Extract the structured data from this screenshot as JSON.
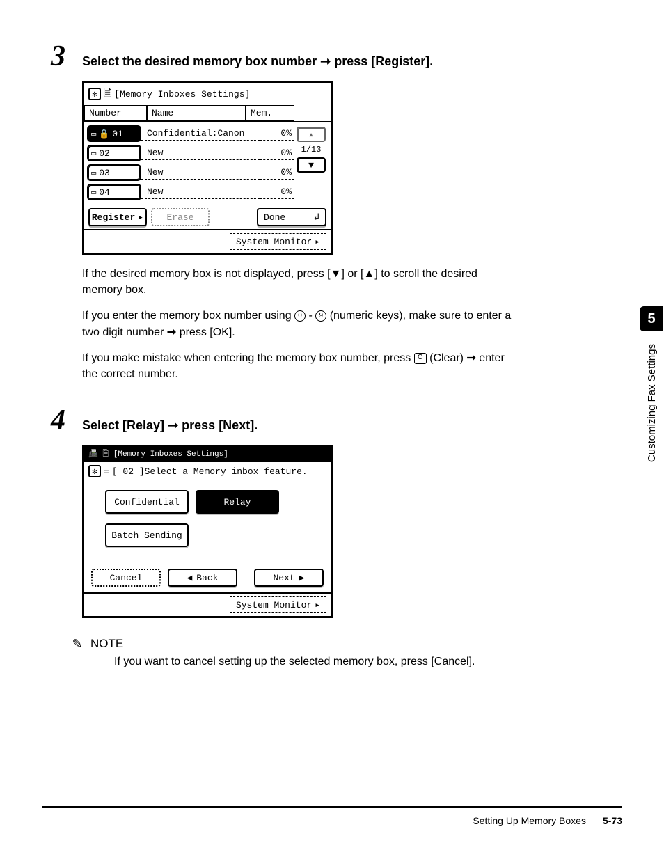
{
  "steps": {
    "s3": {
      "num": "3",
      "title_a": "Select the desired memory box number ",
      "title_arrow": "➞",
      "title_b": " press [Register]."
    },
    "s4": {
      "num": "4",
      "title_a": "Select [Relay] ",
      "title_arrow": "➞",
      "title_b": " press [Next]."
    }
  },
  "screen1": {
    "title": "[Memory Inboxes Settings]",
    "headers": {
      "num": "Number",
      "name": "Name",
      "mem": "Mem."
    },
    "rows": [
      {
        "num": "01",
        "name": "Confidential:Canon",
        "mem": "0%",
        "selected": true,
        "locked": true
      },
      {
        "num": "02",
        "name": "New",
        "mem": "0%",
        "selected": false,
        "locked": false
      },
      {
        "num": "03",
        "name": "New",
        "mem": "0%",
        "selected": false,
        "locked": false
      },
      {
        "num": "04",
        "name": "New",
        "mem": "0%",
        "selected": false,
        "locked": false
      }
    ],
    "page_indicator": "1/13",
    "register": "Register",
    "erase": "Erase",
    "done": "Done",
    "sysmon": "System Monitor"
  },
  "para1_a": "If the desired memory box is not displayed, press [",
  "para1_b": "] or [",
  "para1_c": "] to scroll the desired memory box.",
  "para2_a": "If you enter the memory box number using ",
  "para2_dash": " - ",
  "para2_b": " (numeric keys), make sure to enter a two digit number ",
  "para2_arrow": "➞",
  "para2_c": " press [OK].",
  "para3_a": "If you make mistake when entering the memory box number, press ",
  "para3_b": " (Clear) ",
  "para3_arrow": "➞",
  "para3_c": " enter the correct number.",
  "screen2": {
    "crumb": "[Memory Inboxes Settings]",
    "title": "[ 02 ]Select a Memory inbox feature.",
    "confidential": "Confidential",
    "relay": "Relay",
    "batch": "Batch Sending",
    "cancel": "Cancel",
    "back": "Back",
    "next": "Next",
    "sysmon": "System Monitor"
  },
  "note": {
    "head": "NOTE",
    "text": "If you want to cancel setting up the selected memory box, press [Cancel]."
  },
  "side": {
    "chapter": "5",
    "label": "Customizing Fax Settings"
  },
  "footer": {
    "section": "Setting Up Memory Boxes",
    "page": "5-73"
  },
  "glyphs": {
    "down": "▼",
    "up": "▲",
    "left": "◀",
    "right": "▶",
    "num0": "0",
    "num9": "9",
    "clear": "C",
    "ret": "↲",
    "play": "▸",
    "upsmall": "▴"
  }
}
